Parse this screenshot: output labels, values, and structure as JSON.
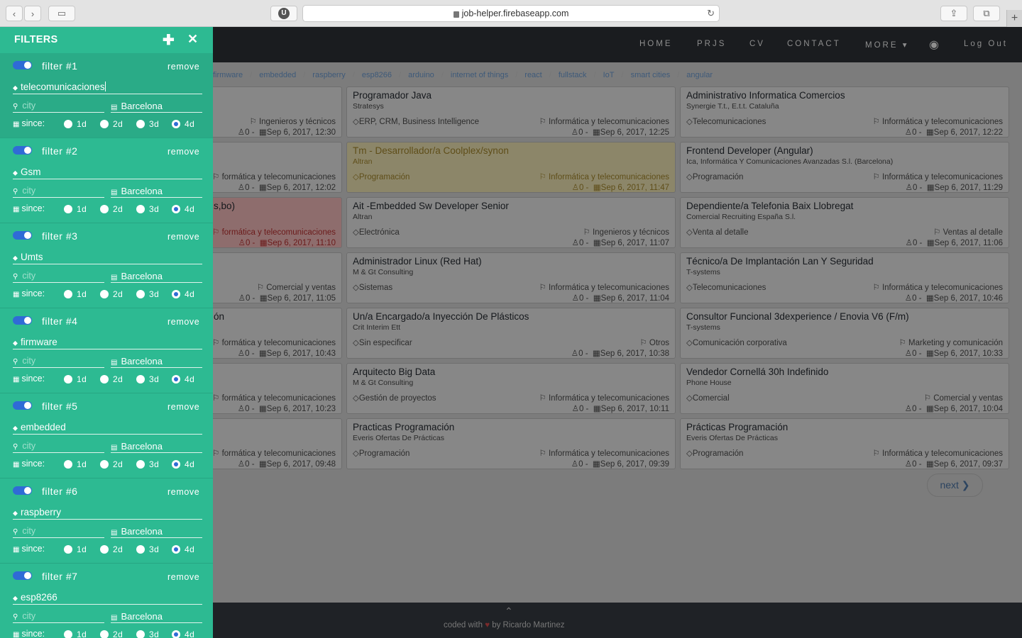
{
  "browser": {
    "url": "job-helper.firebaseapp.com",
    "back_glyph": "‹",
    "forward_glyph": "›",
    "sidebar_glyph": "▭",
    "ext_glyph": "U",
    "reload_glyph": "↻",
    "share_glyph": "⇪",
    "tabs_glyph": "⧉",
    "newtab_glyph": "+"
  },
  "nav": {
    "items": [
      "HOME",
      "PRJS",
      "CV",
      "CONTACT",
      "MORE ▾"
    ],
    "user_glyph": "◉",
    "logout": "Log Out"
  },
  "tags": [
    "firmware",
    "embedded",
    "raspberry",
    "esp8266",
    "arduino",
    "internet of things",
    "react",
    "fullstack",
    "IoT",
    "smart cities",
    "angular"
  ],
  "jobs": {
    "col1": [
      {
        "title": "",
        "company": "",
        "area": "",
        "category": "Ingenieros y técnicos",
        "count": "0",
        "date": "Sep 6, 2017, 12:30"
      },
      {
        "title": "",
        "company": "",
        "area": "",
        "category": "formática y telecomunicaciones",
        "count": "0",
        "date": "Sep 6, 2017, 12:02"
      },
      {
        "title": "s,bo)",
        "company": "",
        "area": "",
        "category": "formática y telecomunicaciones",
        "count": "0",
        "date": "Sep 6, 2017, 11:10"
      },
      {
        "title": "",
        "company": "",
        "area": "",
        "category": "Comercial y ventas",
        "count": "0",
        "date": "Sep 6, 2017, 11:05"
      },
      {
        "title": "ón",
        "company": "",
        "area": "",
        "category": "formática y telecomunicaciones",
        "count": "0",
        "date": "Sep 6, 2017, 10:43"
      },
      {
        "title": "",
        "company": "",
        "area": "",
        "category": "formática y telecomunicaciones",
        "count": "0",
        "date": "Sep 6, 2017, 10:23"
      },
      {
        "title": "",
        "company": "",
        "area": "",
        "category": "formática y telecomunicaciones",
        "count": "0",
        "date": "Sep 6, 2017, 09:48"
      }
    ],
    "col2": [
      {
        "title": "Programador Java",
        "company": "Stratesys",
        "area": "ERP, CRM, Business Intelligence",
        "category": "Informática y telecomunicaciones",
        "count": "0",
        "date": "Sep 6, 2017, 12:25"
      },
      {
        "title": "Tm - Desarrollador/a Coolplex/synon",
        "company": "Altran",
        "area": "Programación",
        "category": "Informática y telecomunicaciones",
        "count": "0",
        "date": "Sep 6, 2017, 11:47"
      },
      {
        "title": "Ait -Embedded Sw Developer Senior",
        "company": "Altran",
        "area": "Electrónica",
        "category": "Ingenieros y técnicos",
        "count": "0",
        "date": "Sep 6, 2017, 11:07"
      },
      {
        "title": "Administrador Linux (Red Hat)",
        "company": "M & Gt Consulting",
        "area": "Sistemas",
        "category": "Informática y telecomunicaciones",
        "count": "0",
        "date": "Sep 6, 2017, 11:04"
      },
      {
        "title": "Un/a Encargado/a Inyección De Plásticos",
        "company": "Crit Interim Ett",
        "area": "Sin especificar",
        "category": "Otros",
        "count": "0",
        "date": "Sep 6, 2017, 10:38"
      },
      {
        "title": "Arquitecto Big Data",
        "company": "M & Gt Consulting",
        "area": "Gestión de proyectos",
        "category": "Informática y telecomunicaciones",
        "count": "0",
        "date": "Sep 6, 2017, 10:11"
      },
      {
        "title": "Practicas Programación",
        "company": "Everis Ofertas De Prácticas",
        "area": "Programación",
        "category": "Informática y telecomunicaciones",
        "count": "0",
        "date": "Sep 6, 2017, 09:39"
      }
    ],
    "col3": [
      {
        "title": "Administrativo Informatica Comercios",
        "company": "Synergie T.t., E.t.t. Cataluña",
        "area": "Telecomunicaciones",
        "category": "Informática y telecomunicaciones",
        "count": "0",
        "date": "Sep 6, 2017, 12:22"
      },
      {
        "title": "Frontend Developer (Angular)",
        "company": "Ica, Informática Y Comunicaciones Avanzadas S.l. (Barcelona)",
        "area": "Programación",
        "category": "Informática y telecomunicaciones",
        "count": "0",
        "date": "Sep 6, 2017, 11:29"
      },
      {
        "title": "Dependiente/a Telefonia Baix Llobregat",
        "company": "Comercial Recruiting España S.l.",
        "area": "Venta al detalle",
        "category": "Ventas al detalle",
        "count": "0",
        "date": "Sep 6, 2017, 11:06"
      },
      {
        "title": "Técnico/a De Implantación Lan Y Seguridad",
        "company": "T-systems",
        "area": "Telecomunicaciones",
        "category": "Informática y telecomunicaciones",
        "count": "0",
        "date": "Sep 6, 2017, 10:46"
      },
      {
        "title": "Consultor Funcional 3dexperience / Enovia V6 (F/m)",
        "company": "T-systems",
        "area": "Comunicación corporativa",
        "category": "Marketing y comunicación",
        "count": "0",
        "date": "Sep 6, 2017, 10:33"
      },
      {
        "title": "Vendedor Cornellá 30h Indefinido",
        "company": "Phone House",
        "area": "Comercial",
        "category": "Comercial y ventas",
        "count": "0",
        "date": "Sep 6, 2017, 10:04"
      },
      {
        "title": "Prácticas Programación",
        "company": "Everis Ofertas De Prácticas",
        "area": "Programación",
        "category": "Informática y telecomunicaciones",
        "count": "0",
        "date": "Sep 6, 2017, 09:37"
      }
    ]
  },
  "glyphs": {
    "bookmark": "⚐",
    "user": "♙",
    "calendar": "▦",
    "diamond": "◇",
    "tag": "⬥",
    "pin": "⚲",
    "map": "▤",
    "dash": "-"
  },
  "pagination": {
    "next": "next ❯"
  },
  "footer": {
    "up_glyph": "⌃",
    "coded_with": "coded with",
    "heart": "♥",
    "by": "by Ricardo Martinez"
  },
  "sidebar": {
    "title": "FILTERS",
    "add_glyph": "✚",
    "close_glyph": "✕",
    "since_label": "since:",
    "remove_label": "remove",
    "city_placeholder": "city",
    "radio_options": [
      "1d",
      "2d",
      "3d",
      "4d"
    ],
    "filters": [
      {
        "name": "filter #1",
        "keyword": "telecomunicaciones",
        "city": "",
        "region": "Barcelona",
        "since": "4d"
      },
      {
        "name": "filter #2",
        "keyword": "Gsm",
        "city": "",
        "region": "Barcelona",
        "since": "4d"
      },
      {
        "name": "filter #3",
        "keyword": "Umts",
        "city": "",
        "region": "Barcelona",
        "since": "4d"
      },
      {
        "name": "filter #4",
        "keyword": "firmware",
        "city": "",
        "region": "Barcelona",
        "since": "4d"
      },
      {
        "name": "filter #5",
        "keyword": "embedded",
        "city": "",
        "region": "Barcelona",
        "since": "4d"
      },
      {
        "name": "filter #6",
        "keyword": "raspberry",
        "city": "",
        "region": "Barcelona",
        "since": "4d"
      },
      {
        "name": "filter #7",
        "keyword": "esp8266",
        "city": "",
        "region": "Barcelona",
        "since": "4d"
      }
    ]
  },
  "colors": {
    "sidebar": "#2dba92",
    "accent": "#2f6bd6",
    "navbar": "#1a1c1f"
  }
}
